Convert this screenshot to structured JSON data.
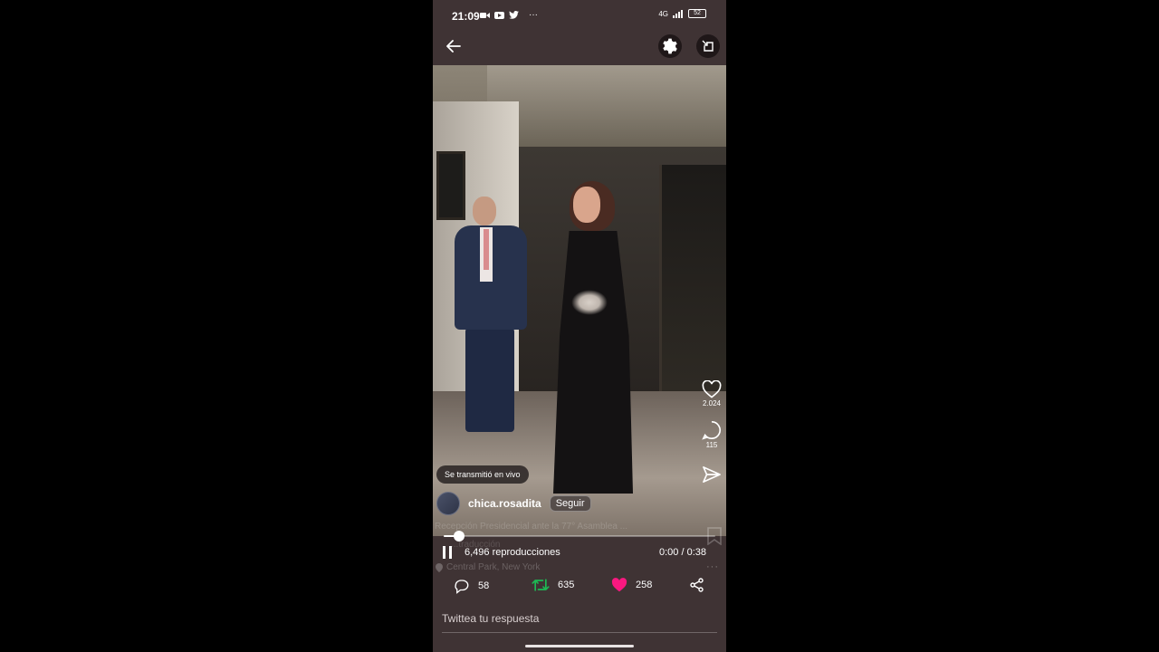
{
  "status_bar": {
    "time": "21:09",
    "network": "4G",
    "battery": "52",
    "more": "···"
  },
  "video": {
    "live_badge": "Se transmitió en vivo",
    "progress": 0.04,
    "views": "6,496 reproducciones",
    "timecode": "0:00 / 0:38"
  },
  "author": {
    "username": "chica.rosadita",
    "follow_label": "Seguir"
  },
  "side_actions": {
    "likes": "2.024",
    "comments": "115"
  },
  "caption": {
    "text": "Recepción Presidencial ante la 77° Asamblea ...",
    "more_text": "...traducción",
    "location": "Central Park, New York",
    "more_icon": "···"
  },
  "engagement": {
    "replies": "58",
    "retweets": "635",
    "likes": "258"
  },
  "reply": {
    "placeholder": "Twittea tu respuesta"
  },
  "colors": {
    "background": "#3f3334",
    "retweet": "#1db954",
    "like": "#f91880"
  }
}
